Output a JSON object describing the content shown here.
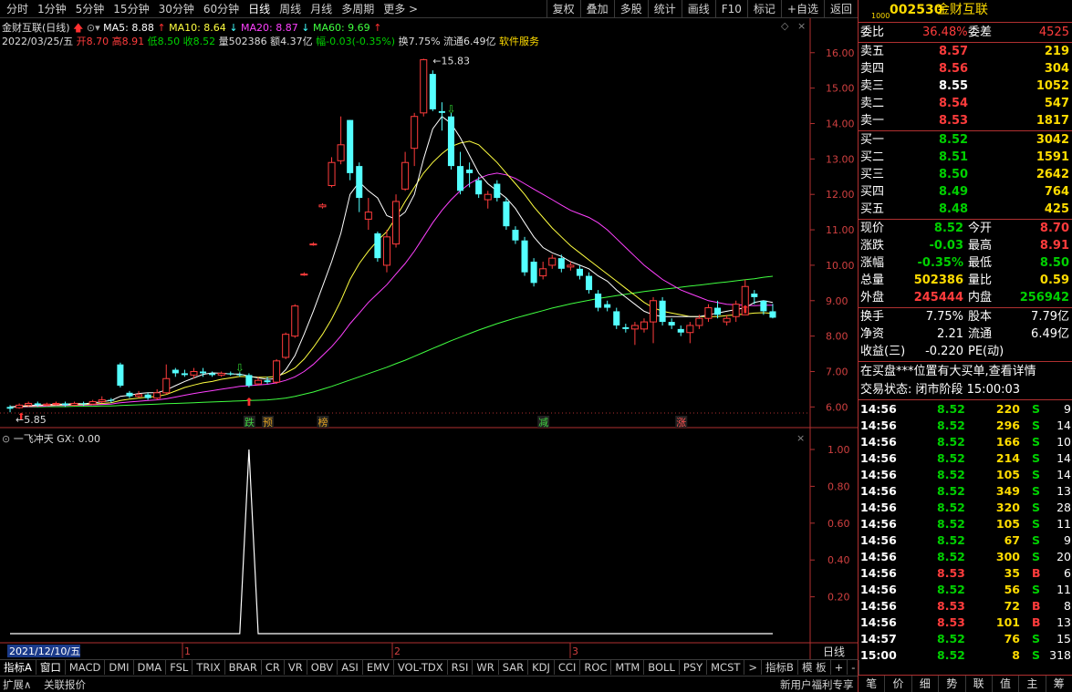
{
  "topbar": {
    "periods": [
      "分时",
      "1分钟",
      "5分钟",
      "15分钟",
      "30分钟",
      "60分钟",
      "日线",
      "周线",
      "月线",
      "多周期",
      "更多 >"
    ],
    "active_period": "日线",
    "actions": [
      "复权",
      "叠加",
      "多股",
      "统计",
      "画线",
      "F10",
      "标记",
      "+自选",
      "返回"
    ]
  },
  "header": {
    "name": "金财互联(日线)",
    "ma5": "MA5: 8.88",
    "ma10": "MA10: 8.64",
    "ma20": "MA20: 8.87",
    "ma60": "MA60: 9.69",
    "date": "2022/03/25/五",
    "open": "开8.70",
    "high": "高8.91",
    "low": "低8.50",
    "close": "收8.52",
    "vol": "量502386",
    "amount": "额4.37亿",
    "change": "幅-0.03(-0.35%)",
    "turnover": "换7.75%",
    "float": "流通6.49亿",
    "sector": "软件服务"
  },
  "colors": {
    "ma5": "#ffffff",
    "ma10": "#ffff40",
    "ma20": "#ff40ff",
    "ma60": "#40ff40",
    "up": "#ff3c3c",
    "down": "#54ffff"
  },
  "chart_data": {
    "type": "candlestick",
    "y_ticks": [
      "16.00",
      "15.00",
      "14.00",
      "13.00",
      "12.00",
      "11.00",
      "10.00",
      "9.00",
      "8.00",
      "7.00",
      "6.00"
    ],
    "ylim": [
      5.7,
      16.2
    ],
    "high_label": "15.83",
    "low_label": "5.85",
    "candles": [
      [
        6.0,
        5.95,
        6.05,
        5.85
      ],
      [
        5.98,
        6.05,
        6.1,
        5.95
      ],
      [
        6.05,
        6.1,
        6.15,
        6.0
      ],
      [
        6.1,
        6.05,
        6.15,
        6.0
      ],
      [
        6.05,
        6.08,
        6.12,
        6.02
      ],
      [
        6.08,
        6.1,
        6.15,
        6.05
      ],
      [
        6.1,
        6.05,
        6.15,
        6.0
      ],
      [
        6.05,
        6.1,
        6.15,
        6.02
      ],
      [
        6.1,
        6.08,
        6.15,
        6.03
      ],
      [
        6.08,
        6.15,
        6.2,
        6.05
      ],
      [
        6.15,
        6.2,
        6.3,
        6.1
      ],
      [
        6.2,
        6.18,
        6.25,
        6.12
      ],
      [
        7.2,
        6.6,
        7.25,
        6.55
      ],
      [
        6.4,
        6.3,
        6.45,
        6.25
      ],
      [
        6.3,
        6.35,
        6.45,
        6.25
      ],
      [
        6.35,
        6.25,
        6.4,
        6.2
      ],
      [
        6.25,
        6.4,
        6.5,
        6.2
      ],
      [
        6.4,
        6.8,
        7.2,
        6.35
      ],
      [
        7.05,
        6.95,
        7.1,
        6.85
      ],
      [
        6.95,
        6.9,
        7.05,
        6.85
      ],
      [
        6.9,
        7.0,
        7.1,
        6.8
      ],
      [
        7.0,
        6.95,
        7.1,
        6.85
      ],
      [
        6.95,
        6.9,
        7.0,
        6.85
      ],
      [
        6.9,
        6.95,
        7.0,
        6.85
      ],
      [
        6.95,
        6.92,
        7.0,
        6.88
      ],
      [
        6.92,
        6.9,
        6.98,
        6.85
      ],
      [
        6.9,
        6.6,
        6.95,
        6.55
      ],
      [
        6.65,
        6.75,
        6.85,
        6.6
      ],
      [
        6.75,
        6.7,
        6.85,
        6.65
      ],
      [
        6.7,
        7.3,
        7.35,
        6.65
      ],
      [
        7.4,
        8.05,
        8.1,
        7.35
      ],
      [
        8.0,
        8.85,
        8.9,
        7.95
      ],
      [
        9.75,
        9.75,
        9.8,
        9.7
      ],
      [
        10.6,
        10.6,
        10.65,
        10.55
      ],
      [
        11.65,
        11.7,
        11.75,
        11.6
      ],
      [
        12.25,
        12.9,
        13.05,
        12.2
      ],
      [
        12.95,
        13.4,
        14.2,
        12.85
      ],
      [
        14.1,
        12.6,
        14.1,
        12.4
      ],
      [
        12.8,
        11.9,
        12.9,
        11.5
      ],
      [
        11.3,
        11.5,
        11.9,
        11.0
      ],
      [
        10.9,
        10.2,
        10.95,
        10.1
      ],
      [
        10.0,
        10.8,
        11.0,
        9.8
      ],
      [
        10.6,
        11.8,
        12.0,
        10.5
      ],
      [
        12.15,
        12.9,
        13.2,
        12.1
      ],
      [
        13.3,
        14.2,
        14.3,
        12.8
      ],
      [
        14.3,
        15.8,
        15.83,
        14.2
      ],
      [
        15.4,
        14.4,
        15.5,
        14.35
      ],
      [
        14.35,
        14.3,
        14.6,
        13.8
      ],
      [
        14.2,
        12.8,
        14.3,
        12.7
      ],
      [
        12.8,
        12.1,
        13.2,
        12.0
      ],
      [
        12.7,
        12.6,
        12.9,
        12.2
      ],
      [
        12.4,
        12.0,
        12.5,
        11.9
      ],
      [
        11.85,
        12.0,
        12.1,
        11.6
      ],
      [
        12.3,
        11.9,
        12.4,
        11.8
      ],
      [
        11.8,
        11.1,
        11.9,
        11.0
      ],
      [
        11.0,
        10.7,
        11.1,
        10.6
      ],
      [
        10.7,
        9.8,
        10.8,
        9.7
      ],
      [
        10.1,
        9.5,
        10.2,
        9.4
      ],
      [
        9.7,
        9.9,
        10.1,
        9.6
      ],
      [
        10.0,
        10.2,
        10.3,
        9.9
      ],
      [
        10.2,
        9.9,
        10.3,
        9.8
      ],
      [
        9.95,
        10.0,
        10.1,
        9.85
      ],
      [
        9.9,
        9.7,
        10.0,
        9.6
      ],
      [
        9.7,
        9.3,
        9.8,
        9.2
      ],
      [
        9.2,
        8.8,
        9.3,
        8.7
      ],
      [
        8.9,
        8.8,
        9.0,
        8.7
      ],
      [
        8.7,
        8.3,
        8.8,
        8.2
      ],
      [
        8.25,
        8.2,
        8.35,
        8.1
      ],
      [
        8.2,
        8.3,
        8.4,
        7.75
      ],
      [
        8.2,
        8.4,
        8.5,
        8.1
      ],
      [
        8.4,
        9.0,
        9.1,
        7.8
      ],
      [
        9.0,
        8.4,
        9.1,
        8.3
      ],
      [
        8.4,
        8.3,
        8.5,
        8.2
      ],
      [
        8.2,
        8.1,
        8.3,
        8.0
      ],
      [
        8.1,
        8.3,
        8.4,
        7.8
      ],
      [
        8.3,
        8.5,
        8.6,
        8.2
      ],
      [
        8.5,
        8.8,
        8.9,
        8.4
      ],
      [
        8.8,
        8.6,
        9.0,
        8.5
      ],
      [
        8.4,
        8.5,
        8.6,
        8.3
      ],
      [
        8.55,
        8.9,
        9.0,
        8.4
      ],
      [
        8.6,
        9.4,
        9.6,
        8.6
      ],
      [
        9.2,
        9.1,
        9.3,
        8.9
      ],
      [
        9.0,
        8.7,
        9.0,
        8.6
      ],
      [
        8.7,
        8.52,
        8.91,
        8.5
      ]
    ],
    "ma5": [
      6.0,
      6.02,
      6.04,
      6.05,
      6.06,
      6.08,
      6.08,
      6.09,
      6.09,
      6.11,
      6.15,
      6.18,
      6.3,
      6.33,
      6.38,
      6.4,
      6.4,
      6.48,
      6.6,
      6.72,
      6.82,
      6.92,
      6.96,
      6.95,
      6.93,
      6.93,
      6.87,
      6.82,
      6.78,
      6.8,
      7.05,
      7.45,
      8.05,
      8.7,
      9.4,
      10.1,
      10.9,
      12.0,
      12.35,
      12.1,
      11.9,
      11.4,
      11.3,
      11.5,
      12.0,
      13.0,
      13.85,
      14.2,
      14.0,
      13.6,
      13.1,
      12.6,
      12.3,
      12.1,
      11.9,
      11.6,
      11.2,
      10.8,
      10.5,
      10.35,
      10.25,
      10.1,
      10.0,
      9.9,
      9.7,
      9.55,
      9.3,
      9.1,
      8.9,
      8.7,
      8.6,
      8.55,
      8.55,
      8.55,
      8.55,
      8.55,
      8.6,
      8.65,
      8.7,
      8.75,
      8.8,
      8.95,
      9.0,
      8.95
    ],
    "ma10": [
      6.0,
      6.01,
      6.03,
      6.04,
      6.05,
      6.06,
      6.06,
      6.07,
      6.07,
      6.08,
      6.1,
      6.12,
      6.18,
      6.22,
      6.25,
      6.28,
      6.3,
      6.35,
      6.45,
      6.55,
      6.62,
      6.68,
      6.72,
      6.78,
      6.82,
      6.86,
      6.85,
      6.84,
      6.84,
      6.86,
      6.96,
      7.1,
      7.35,
      7.68,
      8.05,
      8.48,
      9.0,
      9.6,
      10.05,
      10.4,
      10.7,
      10.95,
      11.35,
      11.8,
      12.2,
      12.6,
      12.9,
      13.15,
      13.35,
      13.45,
      13.5,
      13.4,
      13.15,
      12.9,
      12.6,
      12.3,
      12.0,
      11.65,
      11.35,
      11.05,
      10.8,
      10.55,
      10.35,
      10.15,
      9.95,
      9.75,
      9.55,
      9.35,
      9.15,
      8.95,
      8.8,
      8.7,
      8.65,
      8.6,
      8.55,
      8.55,
      8.55,
      8.55,
      8.58,
      8.6,
      8.62,
      8.65,
      8.66,
      8.64
    ],
    "ma20": [
      6.0,
      6.0,
      6.01,
      6.02,
      6.03,
      6.04,
      6.04,
      6.05,
      6.05,
      6.06,
      6.07,
      6.08,
      6.12,
      6.14,
      6.16,
      6.18,
      6.2,
      6.23,
      6.28,
      6.33,
      6.38,
      6.42,
      6.46,
      6.5,
      6.54,
      6.58,
      6.6,
      6.62,
      6.64,
      6.68,
      6.75,
      6.85,
      7.0,
      7.2,
      7.45,
      7.7,
      8.0,
      8.35,
      8.65,
      8.95,
      9.2,
      9.45,
      9.75,
      10.05,
      10.4,
      10.8,
      11.2,
      11.55,
      11.85,
      12.1,
      12.3,
      12.45,
      12.55,
      12.6,
      12.55,
      12.45,
      12.3,
      12.15,
      12.0,
      11.85,
      11.7,
      11.55,
      11.45,
      11.35,
      11.2,
      11.0,
      10.75,
      10.5,
      10.25,
      10.0,
      9.8,
      9.6,
      9.45,
      9.3,
      9.2,
      9.1,
      9.0,
      8.95,
      8.9,
      8.88,
      8.87,
      8.86,
      8.87,
      8.87
    ],
    "ma60": [
      6.0,
      6.0,
      6.0,
      6.0,
      6.01,
      6.01,
      6.01,
      6.02,
      6.02,
      6.02,
      6.03,
      6.03,
      6.04,
      6.05,
      6.06,
      6.07,
      6.08,
      6.09,
      6.1,
      6.11,
      6.12,
      6.13,
      6.14,
      6.15,
      6.16,
      6.17,
      6.18,
      6.19,
      6.2,
      6.22,
      6.25,
      6.3,
      6.36,
      6.42,
      6.5,
      6.58,
      6.67,
      6.76,
      6.85,
      6.94,
      7.03,
      7.12,
      7.22,
      7.32,
      7.43,
      7.54,
      7.65,
      7.76,
      7.87,
      7.97,
      8.07,
      8.17,
      8.26,
      8.35,
      8.43,
      8.51,
      8.58,
      8.65,
      8.72,
      8.79,
      8.85,
      8.91,
      8.96,
      9.01,
      9.06,
      9.1,
      9.14,
      9.18,
      9.22,
      9.26,
      9.29,
      9.32,
      9.35,
      9.38,
      9.41,
      9.44,
      9.47,
      9.5,
      9.53,
      9.56,
      9.59,
      9.62,
      9.66,
      9.69
    ],
    "events": [
      {
        "idx": 26,
        "label": "跌"
      },
      {
        "idx": 28,
        "label": "预"
      },
      {
        "idx": 34,
        "label": "榜"
      },
      {
        "idx": 58,
        "label": "减"
      },
      {
        "idx": 73,
        "label": "涨"
      }
    ],
    "indicator": {
      "name": "一飞冲天",
      "gx": "GX: 0.00",
      "y_ticks": [
        "1.00",
        "0.80",
        "0.60",
        "0.40",
        "0.20"
      ],
      "values_at": [
        {
          "idx": 26,
          "value": 1.0
        }
      ]
    },
    "x_labels": [
      "2021/12/10/五",
      "1",
      "2",
      "3"
    ]
  },
  "indicator_tabs": [
    "指标A",
    "窗口",
    "MACD",
    "DMI",
    "DMA",
    "FSL",
    "TRIX",
    "BRAR",
    "CR",
    "VR",
    "OBV",
    "ASI",
    "EMV",
    "VOL-TDX",
    "RSI",
    "WR",
    "SAR",
    "KDJ",
    "CCI",
    "ROC",
    "MTM",
    "BOLL",
    "PSY",
    "MCST",
    ">",
    "指标B",
    "模 板",
    "+",
    "-"
  ],
  "bottom_bar": {
    "left1": "扩展∧",
    "left2": "关联报价",
    "right": "新用户福利专享",
    "period_label": "日线"
  },
  "quote": {
    "code": "002530",
    "name": "金财互联",
    "weibi_label": "委比",
    "weibi": "36.48%",
    "weicha_label": "委差",
    "weicha": "4525",
    "asks": [
      {
        "label": "卖五",
        "price": "8.57",
        "vol": "219"
      },
      {
        "label": "卖四",
        "price": "8.56",
        "vol": "304"
      },
      {
        "label": "卖三",
        "price": "8.55",
        "vol": "1052"
      },
      {
        "label": "卖二",
        "price": "8.54",
        "vol": "547"
      },
      {
        "label": "卖一",
        "price": "8.53",
        "vol": "1817"
      }
    ],
    "bids": [
      {
        "label": "买一",
        "price": "8.52",
        "vol": "3042"
      },
      {
        "label": "买二",
        "price": "8.51",
        "vol": "1591"
      },
      {
        "label": "买三",
        "price": "8.50",
        "vol": "2642"
      },
      {
        "label": "买四",
        "price": "8.49",
        "vol": "764"
      },
      {
        "label": "买五",
        "price": "8.48",
        "vol": "425"
      }
    ],
    "stats": [
      {
        "l1": "现价",
        "v1": "8.52",
        "l2": "今开",
        "v2": "8.70"
      },
      {
        "l1": "涨跌",
        "v1": "-0.03",
        "l2": "最高",
        "v2": "8.91"
      },
      {
        "l1": "涨幅",
        "v1": "-0.35%",
        "l2": "最低",
        "v2": "8.50"
      },
      {
        "l1": "总量",
        "v1": "502386",
        "l2": "量比",
        "v2": "0.59"
      },
      {
        "l1": "外盘",
        "v1": "245444",
        "l2": "内盘",
        "v2": "256942"
      }
    ],
    "stats2": [
      {
        "l1": "换手",
        "v1": "7.75%",
        "l2": "股本",
        "v2": "7.79亿"
      },
      {
        "l1": "净资",
        "v1": "2.21",
        "l2": "流通",
        "v2": "6.49亿"
      },
      {
        "l1": "收益(三)",
        "v1": "-0.220",
        "l2": "PE(动)",
        "v2": ""
      }
    ],
    "notice": "在买盘***位置有大买单,查看详情",
    "status": "交易状态: 闭市阶段 15:00:03",
    "ticks": [
      {
        "t": "14:56",
        "p": "8.52",
        "v": "220",
        "s": "S",
        "n": "9"
      },
      {
        "t": "14:56",
        "p": "8.52",
        "v": "296",
        "s": "S",
        "n": "14"
      },
      {
        "t": "14:56",
        "p": "8.52",
        "v": "166",
        "s": "S",
        "n": "10"
      },
      {
        "t": "14:56",
        "p": "8.52",
        "v": "214",
        "s": "S",
        "n": "14"
      },
      {
        "t": "14:56",
        "p": "8.52",
        "v": "105",
        "s": "S",
        "n": "14"
      },
      {
        "t": "14:56",
        "p": "8.52",
        "v": "349",
        "s": "S",
        "n": "13"
      },
      {
        "t": "14:56",
        "p": "8.52",
        "v": "320",
        "s": "S",
        "n": "28"
      },
      {
        "t": "14:56",
        "p": "8.52",
        "v": "105",
        "s": "S",
        "n": "11"
      },
      {
        "t": "14:56",
        "p": "8.52",
        "v": "67",
        "s": "S",
        "n": "9"
      },
      {
        "t": "14:56",
        "p": "8.52",
        "v": "300",
        "s": "S",
        "n": "20"
      },
      {
        "t": "14:56",
        "p": "8.53",
        "v": "35",
        "s": "B",
        "n": "6"
      },
      {
        "t": "14:56",
        "p": "8.52",
        "v": "56",
        "s": "S",
        "n": "11"
      },
      {
        "t": "14:56",
        "p": "8.53",
        "v": "72",
        "s": "B",
        "n": "8"
      },
      {
        "t": "14:56",
        "p": "8.53",
        "v": "101",
        "s": "B",
        "n": "13"
      },
      {
        "t": "14:57",
        "p": "8.52",
        "v": "76",
        "s": "S",
        "n": "15"
      },
      {
        "t": "15:00",
        "p": "8.52",
        "v": "8",
        "s": "S",
        "n": "318"
      }
    ],
    "side_tabs": [
      "笔",
      "价",
      "细",
      "势",
      "联",
      "值",
      "主",
      "筹"
    ]
  }
}
